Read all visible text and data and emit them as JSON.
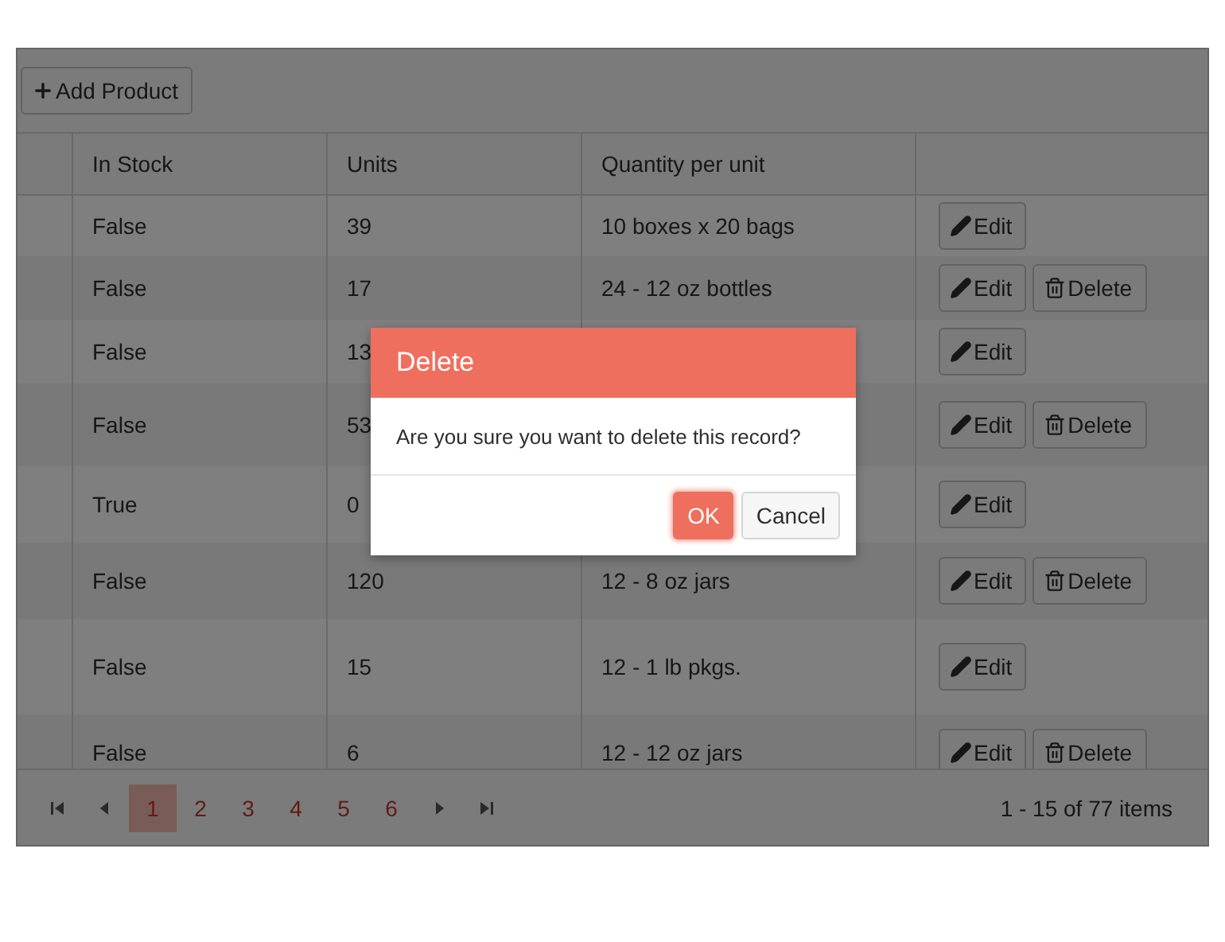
{
  "toolbar": {
    "add_button": "Add Product"
  },
  "table": {
    "columns": [
      "In Stock",
      "Units",
      "Quantity per unit"
    ],
    "rows": [
      {
        "in_stock": "False",
        "units": "39",
        "quantity": "10 boxes x 20 bags",
        "actions": [
          "Edit"
        ]
      },
      {
        "in_stock": "False",
        "units": "17",
        "quantity": "24 - 12 oz bottles",
        "actions": [
          "Edit",
          "Delete"
        ]
      },
      {
        "in_stock": "False",
        "units": "13",
        "actions": [
          "Edit"
        ]
      },
      {
        "in_stock": "False",
        "units": "53",
        "actions": [
          "Edit",
          "Delete"
        ]
      },
      {
        "in_stock": "True",
        "units": "0",
        "actions": [
          "Edit"
        ]
      },
      {
        "in_stock": "False",
        "units": "120",
        "quantity": "12 - 8 oz jars",
        "actions": [
          "Edit",
          "Delete"
        ]
      },
      {
        "in_stock": "False",
        "units": "15",
        "quantity": "12 - 1 lb pkgs.",
        "actions": [
          "Edit"
        ]
      },
      {
        "in_stock": "False",
        "units": "6",
        "quantity": "12 - 12 oz jars",
        "actions": [
          "Edit",
          "Delete"
        ]
      }
    ]
  },
  "pager": {
    "pages": [
      {
        "label": "1",
        "selected": true
      },
      {
        "label": "2",
        "selected": false
      },
      {
        "label": "3",
        "selected": false
      },
      {
        "label": "4",
        "selected": false
      },
      {
        "label": "5",
        "selected": false
      },
      {
        "label": "6",
        "selected": false
      }
    ],
    "info": "1 - 15 of 77 items"
  },
  "dialog": {
    "title": "Delete",
    "message": "Are you sure you want to delete this record?",
    "buttons": [
      {
        "label": "OK",
        "kind": "primary"
      },
      {
        "label": "Cancel",
        "kind": "secondary"
      }
    ]
  }
}
